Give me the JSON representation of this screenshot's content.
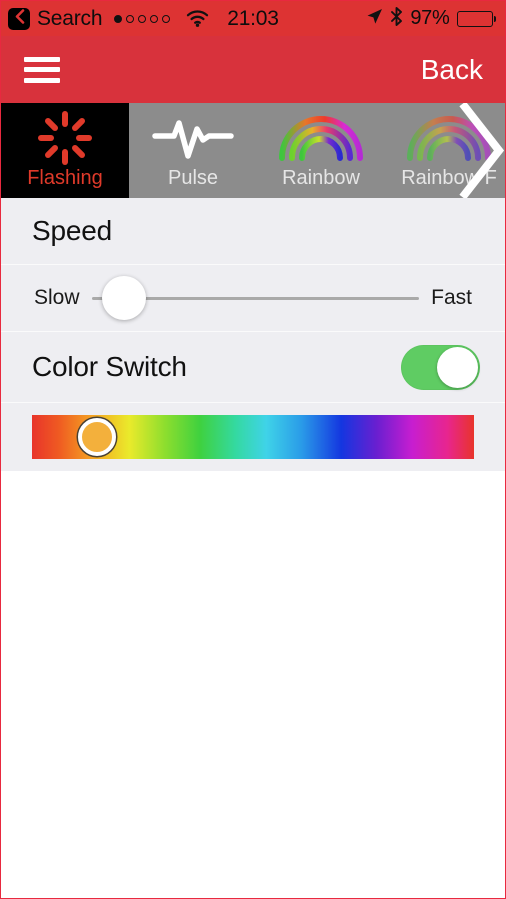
{
  "status_bar": {
    "back_label": "Search",
    "back_icon": "chevron-left-icon",
    "signal_dots_total": 5,
    "signal_dots_filled": 1,
    "wifi_icon": "wifi-icon",
    "time": "21:03",
    "location_icon": "location-arrow-icon",
    "bluetooth_icon": "bluetooth-icon",
    "battery_percent": "97%",
    "battery_level": 97
  },
  "nav_bar": {
    "menu_icon": "hamburger-menu-icon",
    "back_label": "Back",
    "background_color": "#d8323c"
  },
  "tabs": {
    "active_index": 0,
    "scroll_arrow_icon": "chevron-right-icon",
    "items": [
      {
        "label": "Flashing",
        "icon": "flashing-sunburst-icon",
        "selected": true
      },
      {
        "label": "Pulse",
        "icon": "pulse-waveform-icon",
        "selected": false
      },
      {
        "label": "Rainbow",
        "icon": "rainbow-arcs-icon",
        "selected": false
      },
      {
        "label": "Rainbow F",
        "icon": "rainbow-fade-arcs-icon",
        "selected": false
      }
    ]
  },
  "settings": {
    "speed": {
      "header": "Speed",
      "min_label": "Slow",
      "max_label": "Fast",
      "value_percent": 10
    },
    "color_switch": {
      "label": "Color Switch",
      "enabled": true,
      "on_color": "#5fcc63"
    },
    "color_picker": {
      "handle_position_percent": 14.6,
      "selected_color": "#f3b03c"
    }
  }
}
